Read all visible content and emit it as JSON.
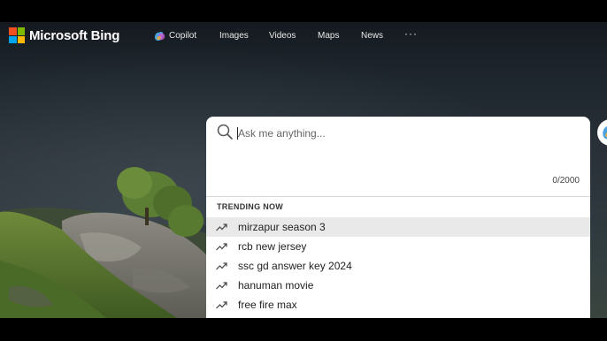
{
  "header": {
    "brand": "Microsoft Bing",
    "logo_colors": [
      "#f25022",
      "#7fba00",
      "#00a4ef",
      "#ffb900"
    ],
    "nav": [
      {
        "label": "Copilot",
        "icon": "copilot-icon"
      },
      {
        "label": "Images"
      },
      {
        "label": "Videos"
      },
      {
        "label": "Maps"
      },
      {
        "label": "News"
      }
    ],
    "more_label": "···"
  },
  "search": {
    "placeholder": "Ask me anything...",
    "value": "",
    "char_count": "0/2000",
    "icon": "search-icon"
  },
  "trending": {
    "heading": "TRENDING NOW",
    "icon": "trending-up-icon",
    "items": [
      {
        "label": "mirzapur season 3",
        "highlighted": true
      },
      {
        "label": "rcb new jersey"
      },
      {
        "label": "ssc gd answer key 2024"
      },
      {
        "label": "hanuman movie"
      },
      {
        "label": "free fire max"
      }
    ]
  },
  "side_button": {
    "icon": "copilot-icon"
  }
}
